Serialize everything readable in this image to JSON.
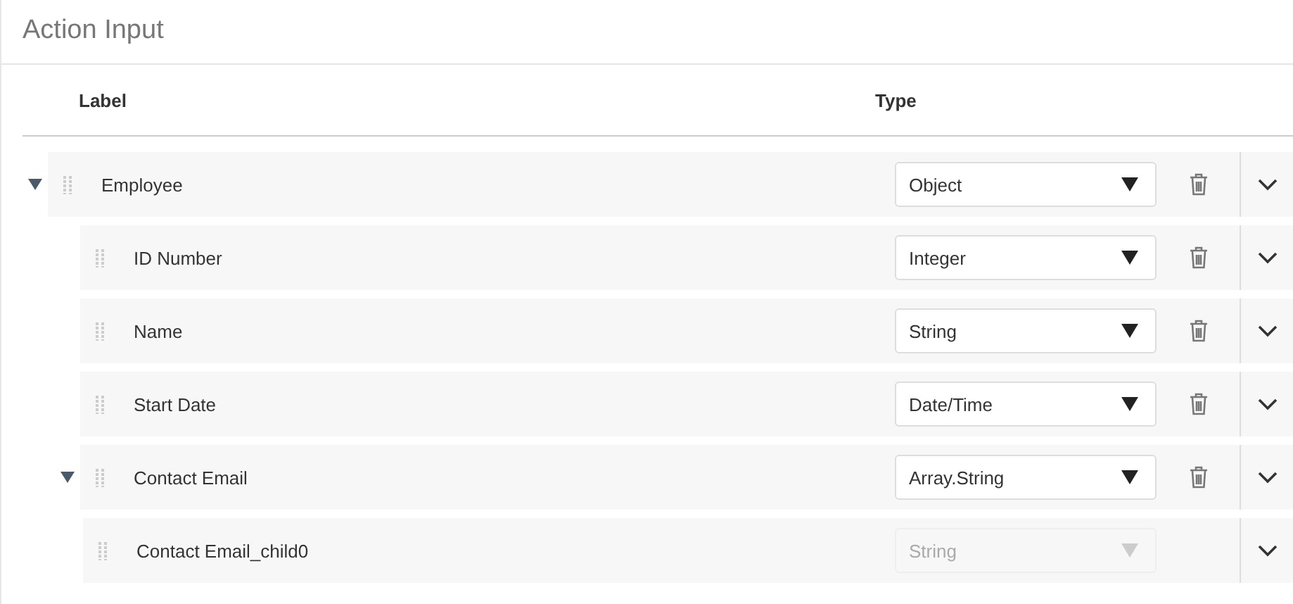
{
  "title": "Action Input",
  "columns": [
    "Label",
    "Type"
  ],
  "fields": [
    {
      "label": "Employee",
      "type": "Object",
      "expanded": true,
      "disabled": false,
      "children": [
        {
          "label": "ID Number",
          "type": "Integer",
          "disabled": false
        },
        {
          "label": "Name",
          "type": "String",
          "disabled": false
        },
        {
          "label": "Start Date",
          "type": "Date/Time",
          "disabled": false
        },
        {
          "label": "Contact Email",
          "type": "Array.String",
          "expanded": true,
          "disabled": false,
          "children": [
            {
              "label": "Contact Email_child0",
              "type": "String",
              "disabled": true
            }
          ]
        }
      ]
    }
  ]
}
